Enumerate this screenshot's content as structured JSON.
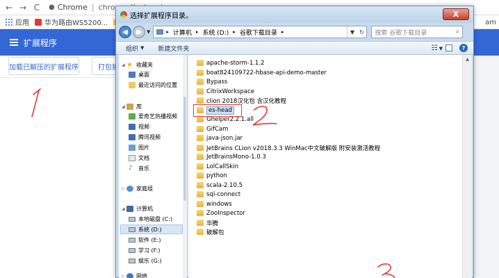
{
  "browser": {
    "url_host": "Chrome",
    "url_path": "chrome://extensions"
  },
  "bookmarks": {
    "apps": "应用",
    "huawei": "华为路由WS5200...",
    "right_partial": "am"
  },
  "extensions": {
    "title": "扩展程序",
    "load_unpacked": "加载已解压的扩展程序",
    "pack": "打包扩展程序"
  },
  "dialog": {
    "title": "选择扩展程序目录。",
    "close": "X",
    "breadcrumb": [
      "计算机",
      "系统 (D:)",
      "谷歌下载目录"
    ],
    "search_placeholder": "搜索 谷歌下载目录",
    "organize": "组织",
    "new_folder": "新建文件夹"
  },
  "nav_pane": {
    "favorites": "收藏夹",
    "desktop": "桌面",
    "recent": "最近访问的位置",
    "library": "库",
    "iqiyi": "爱奇艺热播视频",
    "video": "视频",
    "tencent_video": "腾讯视频",
    "pictures": "图片",
    "documents": "文档",
    "music": "音乐",
    "homegroup": "家庭组",
    "computer": "计算机",
    "drive_c": "本地磁盘 (C:)",
    "drive_d": "系统 (D:)",
    "drive_e": "软件 (E:)",
    "drive_f": "学习 (F:)",
    "drive_g": "娱乐 (G:)",
    "network": "网络"
  },
  "files": [
    "apache-storm-1.1.2",
    "boat824109722-hbase-api-demo-master",
    "Bypass",
    "CitrixWorkspace",
    "clion 2018汉化包 含汉化教程",
    "es-head",
    "Ghelper2.2.1.all",
    "GifCam",
    "java-json.jar",
    "JetBrains CLion v2018.3.3 WinMac中文破解版 附安装激活教程",
    "JetBrainsMono-1.0.3",
    "LolCallSkin",
    "python",
    "scala-2.10.5",
    "sql-connect",
    "windows",
    "ZooInspector",
    "华腾",
    "破解包"
  ],
  "colors": {
    "chrome_blue": "#3367d6",
    "annotation_red": "#e53935"
  }
}
